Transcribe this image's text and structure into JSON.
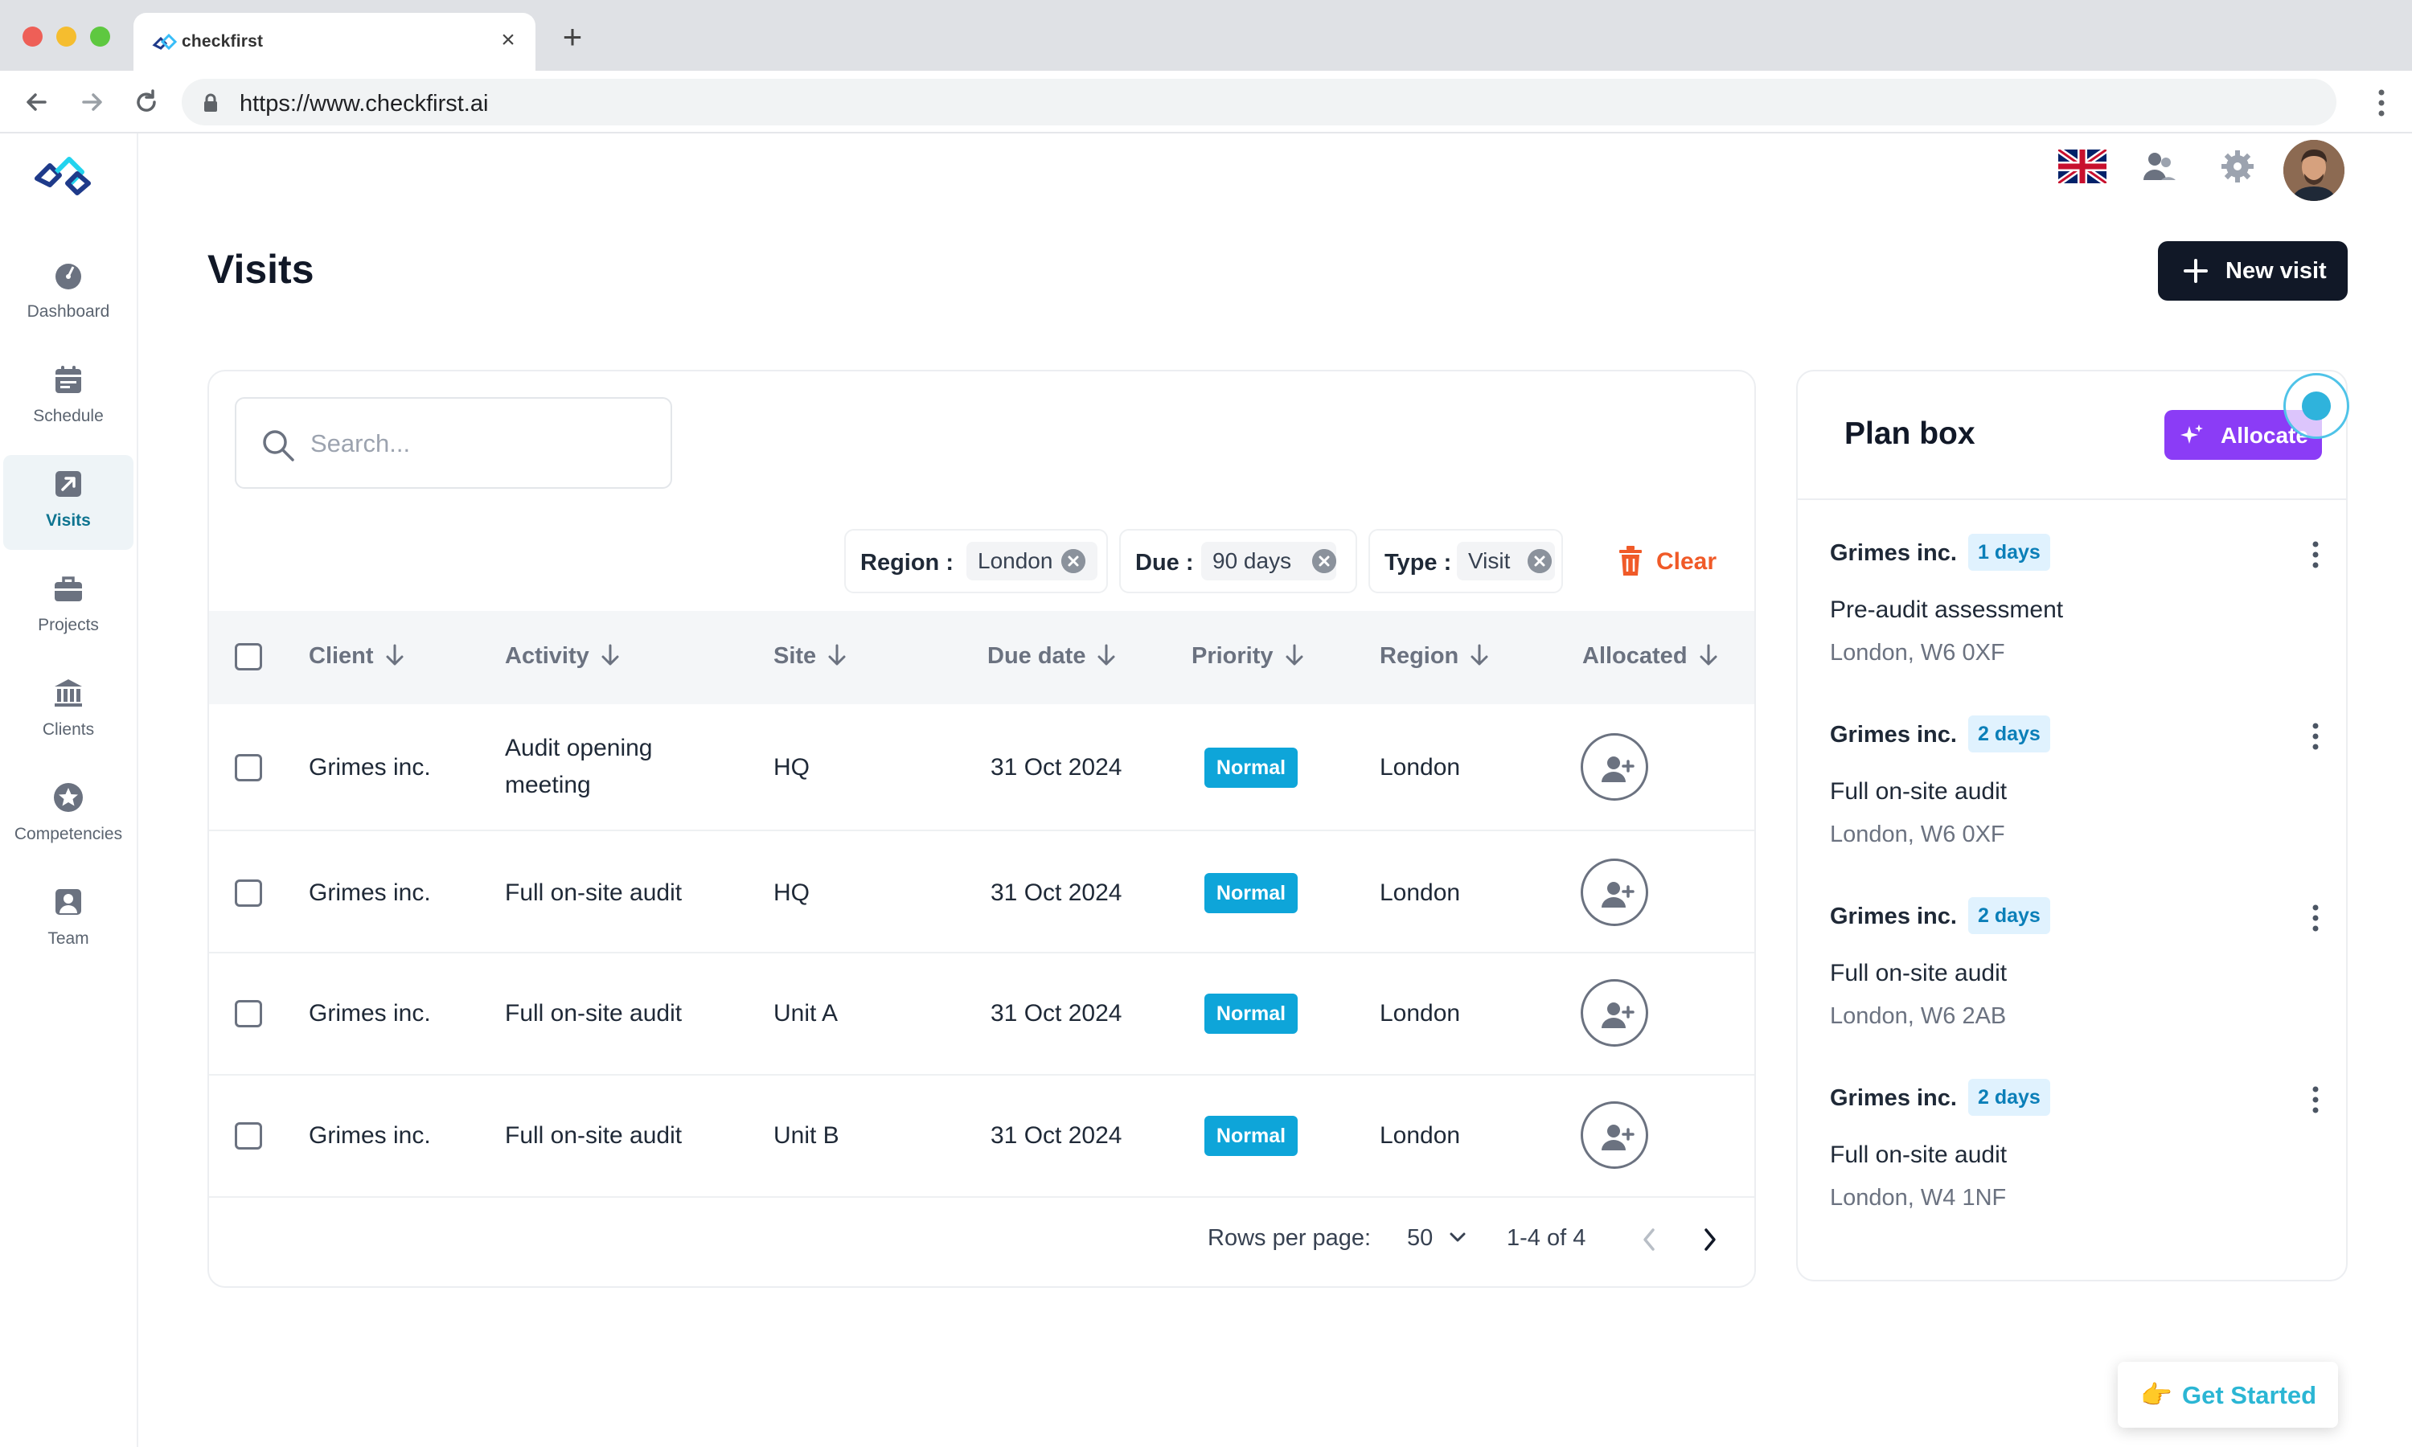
{
  "browser": {
    "tab_title": "checkfirst",
    "url": "https://www.checkfirst.ai"
  },
  "sidebar": {
    "items": [
      {
        "label": "Dashboard",
        "icon": "dashboard-icon"
      },
      {
        "label": "Schedule",
        "icon": "calendar-icon"
      },
      {
        "label": "Visits",
        "icon": "visits-icon",
        "active": true
      },
      {
        "label": "Projects",
        "icon": "briefcase-icon"
      },
      {
        "label": "Clients",
        "icon": "bank-icon"
      },
      {
        "label": "Competencies",
        "icon": "star-icon"
      },
      {
        "label": "Team",
        "icon": "user-icon"
      }
    ]
  },
  "page": {
    "title": "Visits",
    "new_visit_label": "New visit"
  },
  "search": {
    "placeholder": "Search...",
    "value": ""
  },
  "filters": [
    {
      "label": "Region :",
      "value": "London"
    },
    {
      "label": "Due :",
      "value": "90 days"
    },
    {
      "label": "Type :",
      "value": "Visit"
    }
  ],
  "clear_label": "Clear",
  "table": {
    "columns": [
      "Client",
      "Activity",
      "Site",
      "Due date",
      "Priority",
      "Region",
      "Allocated"
    ],
    "rows": [
      {
        "client": "Grimes inc.",
        "activity_line1": "Audit opening",
        "activity_line2": "meeting",
        "site": "HQ",
        "due": "31 Oct 2024",
        "priority": "Normal",
        "region": "London"
      },
      {
        "client": "Grimes inc.",
        "activity_line1": "Full on-site audit",
        "activity_line2": "",
        "site": "HQ",
        "due": "31 Oct 2024",
        "priority": "Normal",
        "region": "London"
      },
      {
        "client": "Grimes inc.",
        "activity_line1": "Full on-site audit",
        "activity_line2": "",
        "site": "Unit A",
        "due": "31 Oct 2024",
        "priority": "Normal",
        "region": "London"
      },
      {
        "client": "Grimes inc.",
        "activity_line1": "Full on-site audit",
        "activity_line2": "",
        "site": "Unit B",
        "due": "31 Oct 2024",
        "priority": "Normal",
        "region": "London"
      }
    ]
  },
  "pagination": {
    "rows_per_page_label": "Rows per page:",
    "rows_per_page": "50",
    "range": "1-4 of 4"
  },
  "plan_box": {
    "title": "Plan box",
    "allocate_label": "Allocate",
    "items": [
      {
        "client": "Grimes inc.",
        "days": "1 days",
        "activity": "Pre-audit assessment",
        "location": "London, W6 0XF"
      },
      {
        "client": "Grimes inc.",
        "days": "2 days",
        "activity": "Full on-site audit",
        "location": "London, W6 0XF"
      },
      {
        "client": "Grimes inc.",
        "days": "2 days",
        "activity": "Full on-site audit",
        "location": "London, W6 2AB"
      },
      {
        "client": "Grimes inc.",
        "days": "2 days",
        "activity": "Full on-site audit",
        "location": "London, W4 1NF"
      }
    ]
  },
  "get_started": {
    "label": "Get Started",
    "icon": "👉"
  },
  "colors": {
    "primary_dark": "#111827",
    "accent_blue": "#0ea5d9",
    "allocate_purple": "#8b3cf6",
    "clear_orange": "#f05a28",
    "teal": "#2bb6d4"
  }
}
